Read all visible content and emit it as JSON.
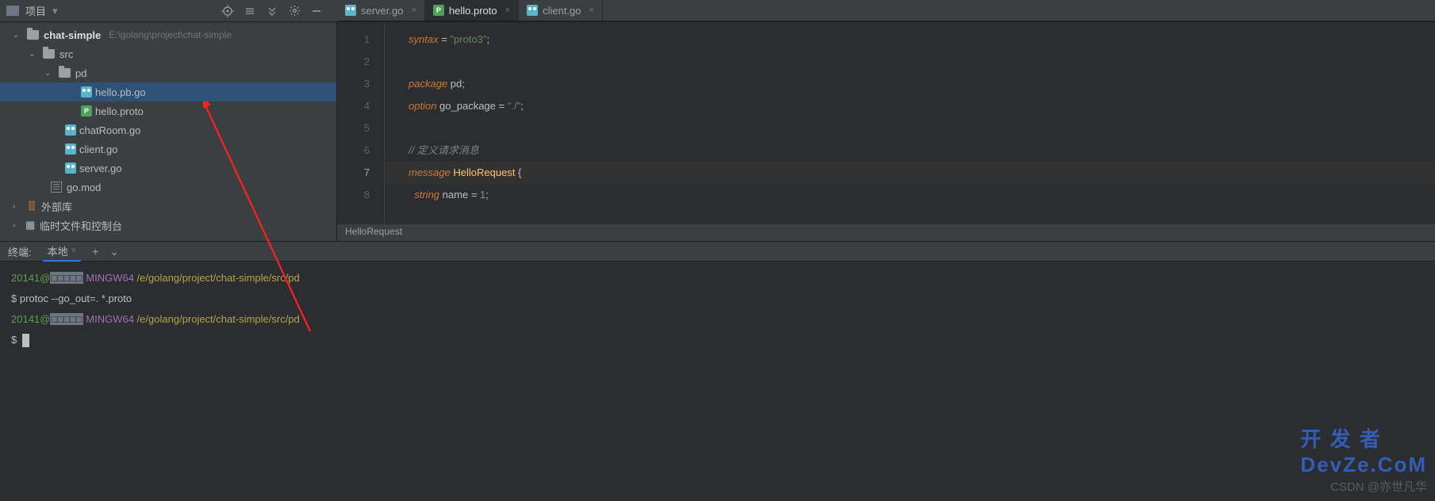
{
  "topbar": {
    "project_label": "项目",
    "dropdown_glyph": "▾"
  },
  "tabs": [
    {
      "name": "server.go",
      "icon": "go",
      "active": false
    },
    {
      "name": "hello.proto",
      "icon": "proto",
      "active": true
    },
    {
      "name": "client.go",
      "icon": "go",
      "active": false
    }
  ],
  "tree": {
    "root": {
      "name": "chat-simple",
      "path": "E:\\golang\\project\\chat-simple"
    },
    "src": "src",
    "pd": "pd",
    "files_pd": [
      {
        "name": "hello.pb.go",
        "icon": "go",
        "selected": true
      },
      {
        "name": "hello.proto",
        "icon": "proto",
        "selected": false
      }
    ],
    "files_src": [
      {
        "name": "chatRoom.go",
        "icon": "go"
      },
      {
        "name": "client.go",
        "icon": "go"
      },
      {
        "name": "server.go",
        "icon": "go"
      }
    ],
    "gomod": "go.mod",
    "ext_lib": "外部库",
    "scratch": "临时文件和控制台"
  },
  "editor": {
    "lines": [
      {
        "n": "1",
        "html": "<span class='kw'>syntax</span> <span class='punct'>=</span> <span class='str'>\"proto3\"</span><span class='punct'>;</span>"
      },
      {
        "n": "2",
        "html": ""
      },
      {
        "n": "3",
        "html": "<span class='kw'>package</span> <span class='ident'>pd</span><span class='punct'>;</span>"
      },
      {
        "n": "4",
        "html": "<span class='kw'>option</span> <span class='ident'>go_package</span> <span class='punct'>=</span> <span class='str'>\"./\"</span><span class='punct'>;</span>"
      },
      {
        "n": "5",
        "html": ""
      },
      {
        "n": "6",
        "html": "<span class='comment'>// 定义请求消息</span>"
      },
      {
        "n": "7",
        "html": "<span class='kw'>message</span> <span class='type'>HelloRequest</span> <span class='punct'>{</span>",
        "hl": true
      },
      {
        "n": "8",
        "html": "  <span class='kw'>string</span> <span class='ident'>name</span> <span class='punct'>=</span> <span class='num'>1</span><span class='punct'>;</span>"
      }
    ],
    "breadcrumb": "HelloRequest"
  },
  "terminal": {
    "header_label": "终端:",
    "tab_label": "本地",
    "plus": "+",
    "chev": "⌄",
    "lines": [
      {
        "html": "<span class='green'>20141@</span><span class='holder'>□□□□□</span> <span class='purple'>MINGW64</span> <span class='yellow'>/e/golang/project/chat-simple/src/pd</span>"
      },
      {
        "html": "$ protoc --go_out=. *.proto"
      },
      {
        "html": ""
      },
      {
        "html": "<span class='green'>20141@</span><span class='holder'>□□□□□</span> <span class='purple'>MINGW64</span> <span class='yellow'>/e/golang/project/chat-simple/src/pd</span>"
      },
      {
        "html": "$ <span class='cursor-block'></span>"
      }
    ]
  },
  "watermark": "CSDN @亦世凡华",
  "watermark2": "开 发 者\nDevZe.CoM"
}
